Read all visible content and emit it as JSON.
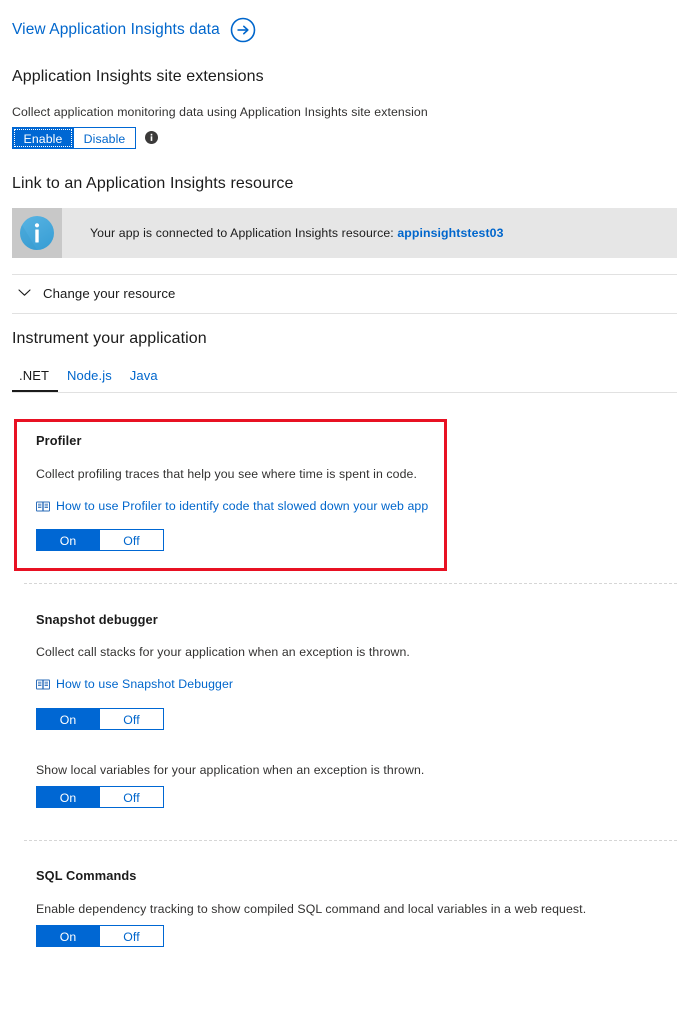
{
  "top_link": {
    "label": "View Application Insights data",
    "icon": "arrow-right-circle-icon"
  },
  "site_extensions": {
    "heading": "Application Insights site extensions",
    "description": "Collect application monitoring data using Application Insights site extension",
    "toggle": {
      "on_label": "Enable",
      "off_label": "Disable",
      "selected": "Enable"
    },
    "info_icon": "info-icon"
  },
  "link_resource": {
    "heading": "Link to an Application Insights resource",
    "banner": {
      "icon": "info-circle-icon",
      "text": "Your app is connected to Application Insights resource:",
      "resource_name": "appinsightstest03"
    },
    "collapse": {
      "label": "Change your resource",
      "icon": "chevron-down-icon",
      "expanded": false
    }
  },
  "instrument": {
    "heading": "Instrument your application",
    "tabs": [
      {
        "label": ".NET",
        "active": true
      },
      {
        "label": "Node.js",
        "active": false
      },
      {
        "label": "Java",
        "active": false
      }
    ]
  },
  "sections": [
    {
      "title": "Profiler",
      "description": "Collect profiling traces that help you see where time is spent in code.",
      "doc_link": {
        "icon": "book-icon",
        "text": "How to use Profiler to identify code that slowed down your web app"
      },
      "toggle": {
        "on_label": "On",
        "off_label": "Off",
        "selected": "On"
      },
      "highlighted": true
    },
    {
      "title": "Snapshot debugger",
      "description": "Collect call stacks for your application when an exception is thrown.",
      "doc_link": {
        "icon": "book-icon",
        "text": "How to use Snapshot Debugger"
      },
      "toggle": {
        "on_label": "On",
        "off_label": "Off",
        "selected": "On"
      },
      "highlighted": false
    },
    {
      "title": "",
      "description": "Show local variables for your application when an exception is thrown.",
      "doc_link": null,
      "toggle": {
        "on_label": "On",
        "off_label": "Off",
        "selected": "On"
      },
      "highlighted": false
    },
    {
      "title": "SQL Commands",
      "description": "Enable dependency tracking to show compiled SQL command and local variables in a web request.",
      "doc_link": null,
      "toggle": {
        "on_label": "On",
        "off_label": "Off",
        "selected": "On"
      },
      "highlighted": false
    }
  ],
  "colors": {
    "accent_blue": "#0067d3",
    "link_blue": "#0066cc",
    "highlight_red": "#e81123",
    "banner_bg": "#e6e6e6",
    "banner_icon_bg": "#c8c8c8"
  }
}
